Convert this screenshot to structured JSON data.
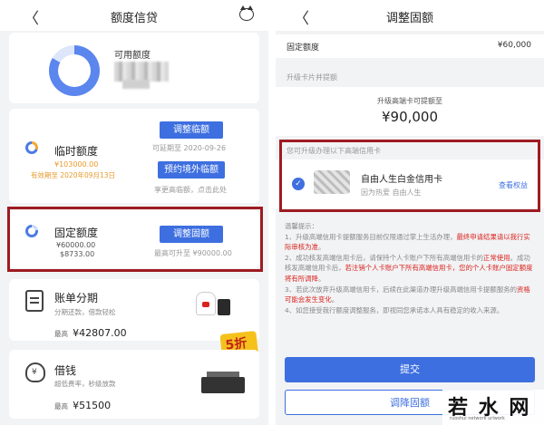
{
  "left": {
    "title": "额度信贷",
    "available_label": "可用额度",
    "temp": {
      "title": "临时额度",
      "amount": "¥103000.00",
      "valid_until": "有效期至 2020年09月13日",
      "adjust_btn": "调整临额",
      "adjust_note": "可延期至 2020-09-26",
      "overseas_btn": "预约境外临额",
      "overseas_note": "享更高临额，点击此处"
    },
    "fixed": {
      "title": "固定额度",
      "amount1": "¥60000.00",
      "amount2": "$8733.00",
      "adjust_btn": "调整固额",
      "max_note": "最高可升至 ¥90000.00"
    },
    "installment": {
      "title": "账单分期",
      "sub": "分期还款，借款轻松",
      "max_label": "最高",
      "max_value": "¥42807.00"
    },
    "loan": {
      "title": "借钱",
      "sub": "超低费率，秒级放款",
      "max_label": "最高",
      "max_value": "¥51500"
    },
    "discount": "5折"
  },
  "right": {
    "title": "调整固额",
    "fixed_label": "固定额度",
    "fixed_value": "¥60,000",
    "upgrade_section": "升级卡片并提额",
    "upgrade_sub": "升级高端卡可提额至",
    "upgrade_amount": "¥90,000",
    "eligible_label": "您可升级办理以下高端信用卡",
    "card_name": "自由人生白金信用卡",
    "card_sub": "因为热爱 自由人生",
    "card_link": "查看权益",
    "tips_title": "温馨提示：",
    "tips": [
      {
        "a": "1、升级高端信用卡提额服务目前仅限通过掌上生活办理，",
        "b": "最终申请结果请以我行实际审核为准",
        "c": "。"
      },
      {
        "a": "2、成功核发高端信用卡后，请保持个人卡账户下所有高端信用卡的",
        "b": "正常使用",
        "c": "。"
      },
      {
        "a": "成功核发高端信用卡后，",
        "b": "若注销个人卡账户下所有高端信用卡，您的个人卡账户固定额度将有所调降",
        "c": "。"
      },
      {
        "a": "3、若此次放弃升级高端信用卡，后续在此渠道办理升级高端信用卡提额服务的",
        "b": "资格可能会发生变化",
        "c": "。"
      },
      {
        "a": "4、如您接受我行额度调整服务，即视同您承诺本人具有稳定的收入来源。",
        "b": "",
        "c": ""
      }
    ],
    "submit": "提交",
    "reduce": "调降固额",
    "watermark": "若 水 网",
    "watermark_sub": "ruoshui  network  urlwork"
  },
  "colors": {
    "accent": "#3d6fe0",
    "highlight": "#9e1b22",
    "orange": "#e89a2c",
    "warning": "#d9231d"
  }
}
